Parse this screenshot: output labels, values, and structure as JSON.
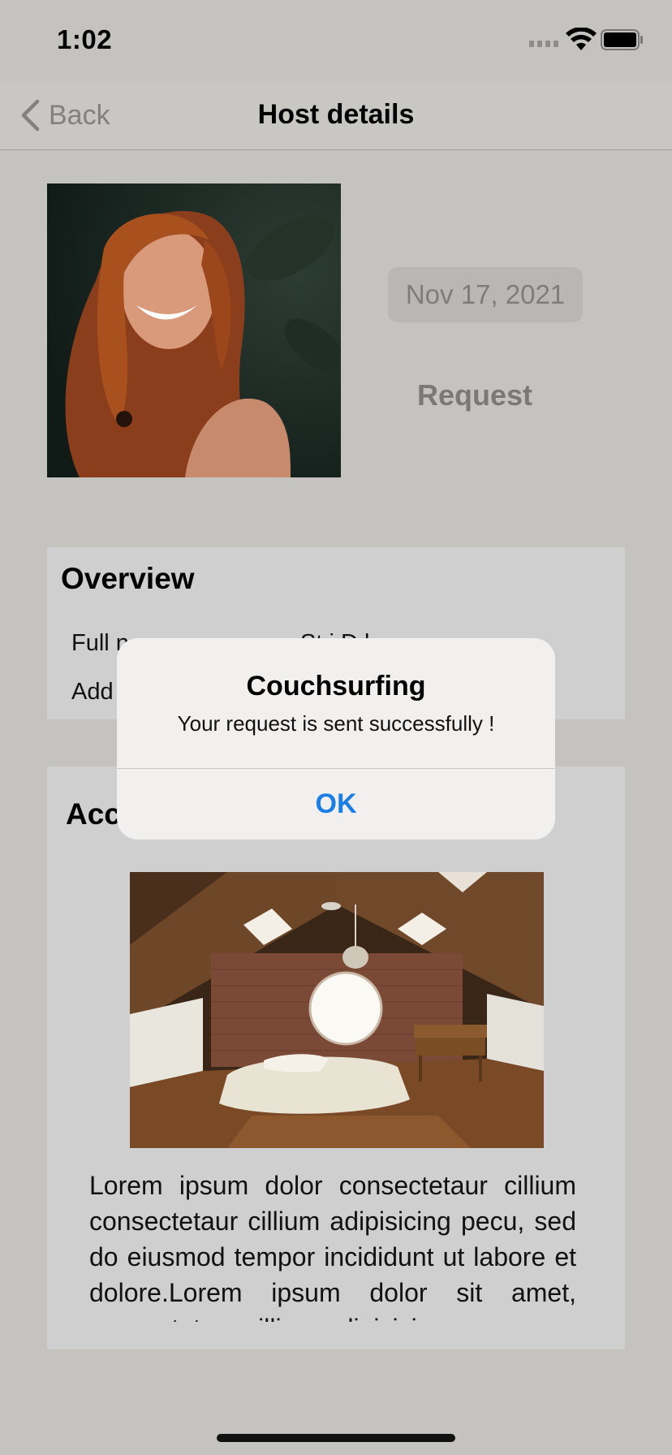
{
  "status_bar": {
    "time": "1:02",
    "signal_icon": "cellular-signal-icon",
    "wifi_icon": "wifi-icon",
    "battery_icon": "battery-icon"
  },
  "nav": {
    "back_label": "Back",
    "back_icon": "chevron-left-icon",
    "title": "Host details"
  },
  "host": {
    "photo": "host-portrait-photo",
    "date": "Nov 17, 2021",
    "request_label": "Request"
  },
  "overview": {
    "title": "Overview",
    "rows": [
      {
        "label": "Full n",
        "value": "St  i  D  l"
      },
      {
        "label": "Add",
        "value": ""
      }
    ]
  },
  "accommodation": {
    "title": "Acc",
    "photo": "attic-bedroom-photo",
    "description": "Lorem ipsum dolor consectetaur cillium consectetaur cillium adipisicing pecu, sed do eiusmod tempor incididunt ut labore et dolore.Lorem ipsum dolor sit amet, consectetaur cillium adipisicing"
  },
  "alert": {
    "title": "Couchsurfing",
    "message": "Your request is sent successfully !",
    "ok_label": "OK"
  },
  "colors": {
    "background": "#c4c3bf",
    "card": "#cfcfcf",
    "accent": "#1a7ee6",
    "alert_bg": "#f1f0ef"
  }
}
